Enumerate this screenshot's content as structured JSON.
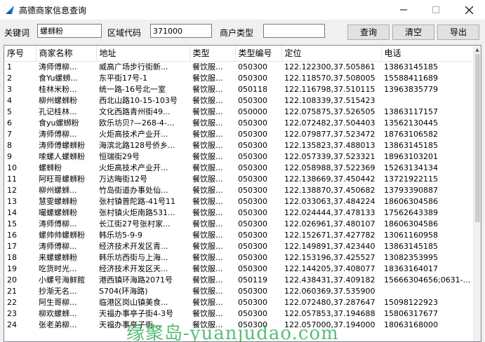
{
  "window": {
    "title": "高德商家信息查询"
  },
  "toolbar": {
    "keyword_label": "关键词",
    "keyword_value": "螺蛳粉",
    "region_label": "区域代码",
    "region_value": "371000",
    "type_label": "商户类型",
    "type_value": "",
    "query_label": "查询",
    "clear_label": "清空",
    "export_label": "导出"
  },
  "table": {
    "columns": [
      "序号",
      "商家名称",
      "地址",
      "类型",
      "类型编号",
      "定位",
      "电话"
    ],
    "rows": [
      [
        "1",
        "涛师傅柳...",
        "威高广场步行街新...",
        "餐饮服...",
        "050300",
        "122.122300,37.505861",
        "13863145185"
      ],
      [
        "2",
        "食Yu螺蛳...",
        "东平街17号-1",
        "餐饮服...",
        "050300",
        "122.118570,37.508005",
        "15588411689"
      ],
      [
        "3",
        "桂林米粉...",
        "统一路-16号北一室",
        "餐饮服...",
        "050118",
        "122.116798,37.510115",
        "13963835779"
      ],
      [
        "4",
        "柳州螺蛳粉",
        "西北山路10-15-103号",
        "餐饮服...",
        "050300",
        "122.108339,37.515423",
        ""
      ],
      [
        "5",
        "孔记桂林...",
        "文化西路青州街49...",
        "餐饮服...",
        "050000",
        "122.075875,37.526505",
        "13863117157"
      ],
      [
        "6",
        "食yu螺蛳粉",
        "欧乐坊贝?—268-4-...",
        "餐饮服...",
        "050300",
        "122.072482,37.504403",
        "13562130445"
      ],
      [
        "7",
        "涛师傅柳...",
        "火炬高技术产业开...",
        "餐饮服...",
        "050300",
        "122.079877,37.523472",
        "18763106582"
      ],
      [
        "8",
        "涛师傅螺蛳粉",
        "海滨北路128号侨乡...",
        "餐饮服...",
        "050300",
        "122.135823,37.488013",
        "13863145185"
      ],
      [
        "9",
        "嗦螺人螺蛳粉",
        "恒瑞街29号",
        "餐饮服...",
        "050300",
        "122.057339,37.523321",
        "18963103201"
      ],
      [
        "10",
        "螺蛳粉",
        "火炬高技术产业开...",
        "餐饮服...",
        "050300",
        "122.058988,37.522369",
        "15263134134"
      ],
      [
        "11",
        "阿旺哥螺蛳粉",
        "万达晦街12号",
        "餐饮服...",
        "050300",
        "122.138669,37.450442",
        "13721922115"
      ],
      [
        "12",
        "柳州螺蛳...",
        "竹岛街道办事处仙...",
        "餐饮服...",
        "050300",
        "122.138870,37.450682",
        "13793390887"
      ],
      [
        "13",
        "慧雯螺蛳粉",
        "张村镇普陀路-41号11",
        "餐饮服...",
        "050300",
        "122.033063,37.484224",
        "18606304586"
      ],
      [
        "14",
        "嘬螺螺蛳粉",
        "张村镇火炬南路531...",
        "餐饮服...",
        "050300",
        "122.024444,37.478133",
        "17562643389"
      ],
      [
        "15",
        "涛师傅柳...",
        "长江街27号张村家...",
        "餐饮服...",
        "050300",
        "122.026961,37.480107",
        "18606304586"
      ],
      [
        "16",
        "螺帅帅螺蛳粉",
        "韩乐坊5-9-9",
        "餐饮服...",
        "050300",
        "122.152671,37.427782",
        "13061160958"
      ],
      [
        "17",
        "涛师傅柳...",
        "经济技术开发区青...",
        "餐饮服...",
        "050300",
        "122.149891,37.423440",
        "13863145185"
      ],
      [
        "18",
        "来螺螺蛳粉",
        "韩乐坊西街与上海...",
        "餐饮服...",
        "050300",
        "122.153196,37.425527",
        "13082353995"
      ],
      [
        "19",
        "吃货时光...",
        "经济技术开发区天...",
        "餐饮服...",
        "050300",
        "122.144205,37.408077",
        "18363164017"
      ],
      [
        "20",
        "小螺号海鲜館",
        "港西镇环海路2071号",
        "餐饮服...",
        "050119",
        "122.438431,37.409182",
        "15666304656;0631-..."
      ],
      [
        "21",
        "抄渐无名...",
        "S704(环海路)",
        "餐饮服...",
        "050300",
        "122.060369,37.535900",
        ""
      ],
      [
        "22",
        "阿生哥柳...",
        "临港区岗山镇美食...",
        "餐饮服...",
        "050300",
        "122.072480,37.287647",
        "15098122923"
      ],
      [
        "23",
        "柳欢螺蛳...",
        "天福办事亭子街4-3号",
        "餐饮服...",
        "050300",
        "122.057853,37.194688",
        "15806317677"
      ],
      [
        "24",
        "张老弟柳...",
        "天福办事亭子街...",
        "餐饮服...",
        "050300",
        "122.057000,37.194000",
        "18063168000"
      ]
    ]
  },
  "watermark": "缘聚岛-yuanjudao.com",
  "colors": {
    "watermark": "#28aa50",
    "grid_border": "#828790",
    "button_bg": "#e1e1e1"
  }
}
